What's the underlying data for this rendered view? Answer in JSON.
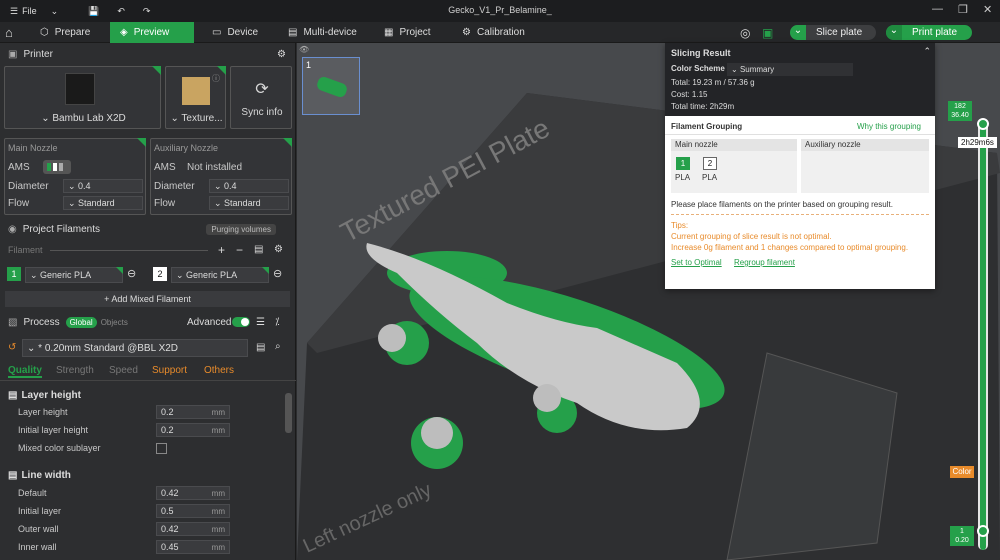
{
  "titlebar": {
    "file_label": "File",
    "title": "Gecko_V1_Pr_Belamine_"
  },
  "tabs": [
    {
      "label": "Prepare"
    },
    {
      "label": "Preview"
    },
    {
      "label": "Device"
    },
    {
      "label": "Multi-device"
    },
    {
      "label": "Project"
    },
    {
      "label": "Calibration"
    }
  ],
  "actions": {
    "slice": "Slice plate",
    "print": "Print plate"
  },
  "printer": {
    "section": "Printer",
    "name": "Bambu Lab X2D",
    "plate": "Texture...",
    "sync": "Sync info"
  },
  "nozzles": {
    "main": {
      "title": "Main Nozzle",
      "ams_label": "AMS",
      "diameter_label": "Diameter",
      "diameter": "0.4",
      "flow_label": "Flow",
      "flow": "Standard"
    },
    "aux": {
      "title": "Auxiliary Nozzle",
      "ams_label": "AMS",
      "ams_value": "Not installed",
      "diameter_label": "Diameter",
      "diameter": "0.4",
      "flow_label": "Flow",
      "flow": "Standard"
    }
  },
  "filaments": {
    "section": "Project Filaments",
    "purge": "Purging volumes",
    "filament_label": "Filament",
    "items": [
      {
        "index": "1",
        "name": "Generic PLA",
        "color": "#25a04a"
      },
      {
        "index": "2",
        "name": "Generic PLA",
        "color": "#ffffff"
      }
    ],
    "add_mixed": "+ Add Mixed Filament"
  },
  "process": {
    "section": "Process",
    "global": "Global",
    "objects": "Objects",
    "advanced": "Advanced",
    "preset": "* 0.20mm Standard @BBL X2D",
    "tabs": [
      "Quality",
      "Strength",
      "Speed",
      "Support",
      "Others"
    ]
  },
  "settings": {
    "layer_height_group": "Layer height",
    "layer_height_label": "Layer height",
    "layer_height": "0.2",
    "initial_layer_height_label": "Initial layer height",
    "initial_layer_height": "0.2",
    "mixed_color_label": "Mixed color sublayer",
    "line_width_group": "Line width",
    "default_label": "Default",
    "default": "0.42",
    "initial_layer_label": "Initial layer",
    "initial_layer": "0.5",
    "outer_wall_label": "Outer wall",
    "outer_wall": "0.42",
    "inner_wall_label": "Inner wall",
    "inner_wall": "0.45",
    "unit": "mm"
  },
  "plate_thumb": {
    "number": "1"
  },
  "bed_text": {
    "main": "Textured PEI Plate",
    "side": "Left nozzle only"
  },
  "slicing_result": {
    "title": "Slicing Result",
    "color_scheme_label": "Color Scheme",
    "color_scheme_value": "Summary",
    "total": "Total:  19.23 m / 57.36 g",
    "cost": "Cost:  1.15",
    "time": "Total time:  2h29m",
    "grouping_title": "Filament Grouping",
    "why": "Why this grouping",
    "main_nozzle": "Main nozzle",
    "aux_nozzle": "Auxiliary nozzle",
    "chips": [
      {
        "index": "1",
        "type": "PLA"
      },
      {
        "index": "2",
        "type": "PLA"
      }
    ],
    "instruction": "Please place filaments on the printer based on grouping result.",
    "tips_label": "Tips:",
    "tip1": "Current grouping of slice result is not optimal.",
    "tip2": "Increase 0g filament and 1 changes compared to optimal grouping.",
    "set_optimal": "Set to Optimal",
    "regroup": "Regroup filament"
  },
  "layer_slider": {
    "top_layers": "182",
    "top_height": "36.40",
    "time": "2h29m6s",
    "color_btn": "Color",
    "bottom_layers": "1",
    "bottom_height": "0.20"
  }
}
